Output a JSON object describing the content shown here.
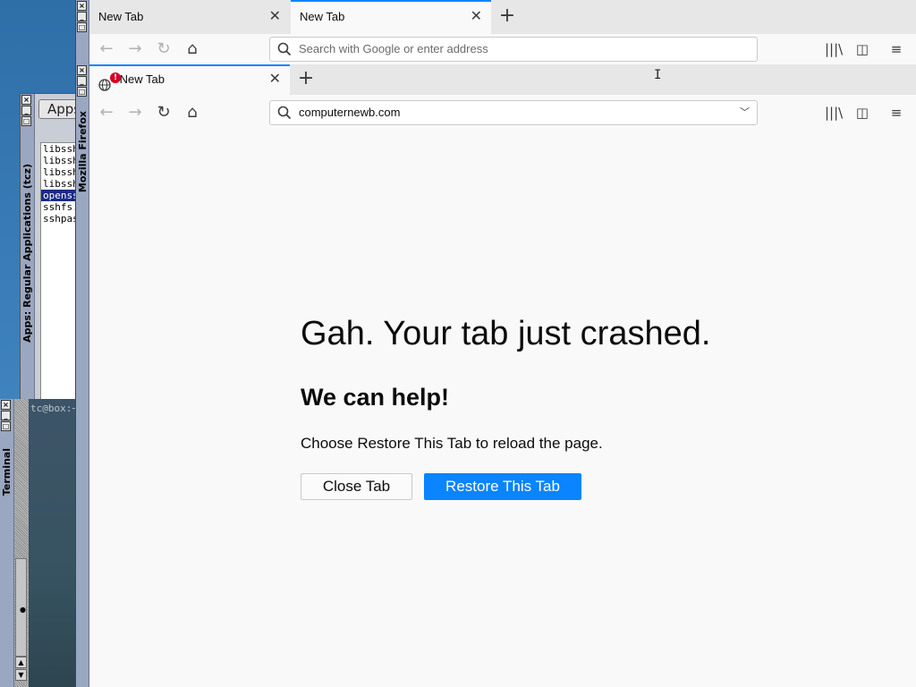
{
  "apps_window": {
    "title": "Apps: Regular Applications (tcz)",
    "button_label": "Apps",
    "items": [
      "libssh",
      "libssh",
      "libssh",
      "libssh",
      "openss",
      "sshfs.",
      "sshpas"
    ],
    "selected_index": 4
  },
  "terminal_window": {
    "title": "Terminal",
    "prompt": "tc@box:~"
  },
  "firefox_back": {
    "tabs": [
      {
        "label": "New Tab",
        "active": false
      },
      {
        "label": "New Tab",
        "active": true
      }
    ],
    "url_placeholder": "Search with Google or enter address"
  },
  "firefox_front": {
    "window_title": "Mozilla Firefox",
    "tab_label": "New Tab",
    "tab_badge": "!",
    "url": "computernewb.com"
  },
  "crash_page": {
    "title": "Gah. Your tab just crashed.",
    "subtitle": "We can help!",
    "message": "Choose Restore This Tab to reload the page.",
    "close_button": "Close Tab",
    "restore_button": "Restore This Tab"
  },
  "colors": {
    "accent": "#0a84ff",
    "selection": "#1c2a86",
    "wm_bar": "#9aa7c0"
  }
}
